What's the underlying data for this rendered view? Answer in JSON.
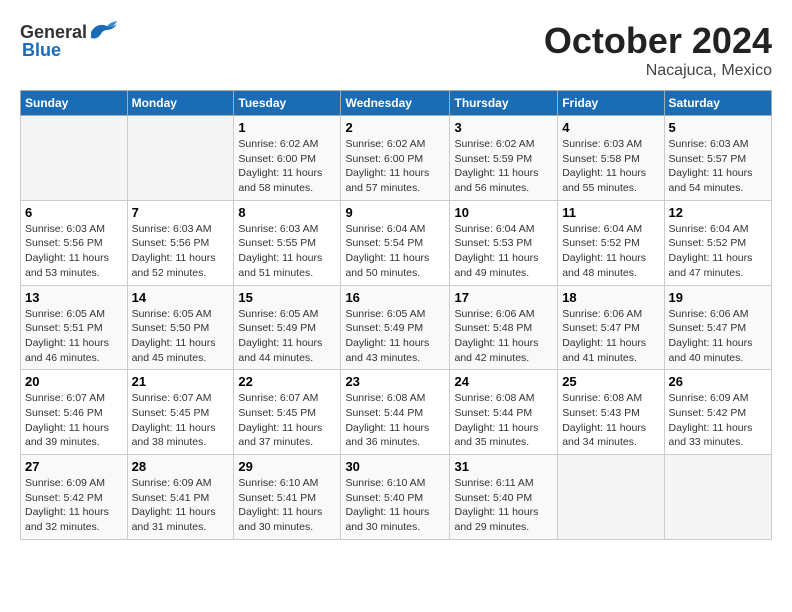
{
  "header": {
    "logo_general": "General",
    "logo_blue": "Blue",
    "month": "October 2024",
    "location": "Nacajuca, Mexico"
  },
  "weekdays": [
    "Sunday",
    "Monday",
    "Tuesday",
    "Wednesday",
    "Thursday",
    "Friday",
    "Saturday"
  ],
  "weeks": [
    [
      {
        "day": "",
        "empty": true
      },
      {
        "day": "",
        "empty": true
      },
      {
        "day": "1",
        "sunrise": "6:02 AM",
        "sunset": "6:00 PM",
        "daylight": "11 hours and 58 minutes."
      },
      {
        "day": "2",
        "sunrise": "6:02 AM",
        "sunset": "6:00 PM",
        "daylight": "11 hours and 57 minutes."
      },
      {
        "day": "3",
        "sunrise": "6:02 AM",
        "sunset": "5:59 PM",
        "daylight": "11 hours and 56 minutes."
      },
      {
        "day": "4",
        "sunrise": "6:03 AM",
        "sunset": "5:58 PM",
        "daylight": "11 hours and 55 minutes."
      },
      {
        "day": "5",
        "sunrise": "6:03 AM",
        "sunset": "5:57 PM",
        "daylight": "11 hours and 54 minutes."
      }
    ],
    [
      {
        "day": "6",
        "sunrise": "6:03 AM",
        "sunset": "5:56 PM",
        "daylight": "11 hours and 53 minutes."
      },
      {
        "day": "7",
        "sunrise": "6:03 AM",
        "sunset": "5:56 PM",
        "daylight": "11 hours and 52 minutes."
      },
      {
        "day": "8",
        "sunrise": "6:03 AM",
        "sunset": "5:55 PM",
        "daylight": "11 hours and 51 minutes."
      },
      {
        "day": "9",
        "sunrise": "6:04 AM",
        "sunset": "5:54 PM",
        "daylight": "11 hours and 50 minutes."
      },
      {
        "day": "10",
        "sunrise": "6:04 AM",
        "sunset": "5:53 PM",
        "daylight": "11 hours and 49 minutes."
      },
      {
        "day": "11",
        "sunrise": "6:04 AM",
        "sunset": "5:52 PM",
        "daylight": "11 hours and 48 minutes."
      },
      {
        "day": "12",
        "sunrise": "6:04 AM",
        "sunset": "5:52 PM",
        "daylight": "11 hours and 47 minutes."
      }
    ],
    [
      {
        "day": "13",
        "sunrise": "6:05 AM",
        "sunset": "5:51 PM",
        "daylight": "11 hours and 46 minutes."
      },
      {
        "day": "14",
        "sunrise": "6:05 AM",
        "sunset": "5:50 PM",
        "daylight": "11 hours and 45 minutes."
      },
      {
        "day": "15",
        "sunrise": "6:05 AM",
        "sunset": "5:49 PM",
        "daylight": "11 hours and 44 minutes."
      },
      {
        "day": "16",
        "sunrise": "6:05 AM",
        "sunset": "5:49 PM",
        "daylight": "11 hours and 43 minutes."
      },
      {
        "day": "17",
        "sunrise": "6:06 AM",
        "sunset": "5:48 PM",
        "daylight": "11 hours and 42 minutes."
      },
      {
        "day": "18",
        "sunrise": "6:06 AM",
        "sunset": "5:47 PM",
        "daylight": "11 hours and 41 minutes."
      },
      {
        "day": "19",
        "sunrise": "6:06 AM",
        "sunset": "5:47 PM",
        "daylight": "11 hours and 40 minutes."
      }
    ],
    [
      {
        "day": "20",
        "sunrise": "6:07 AM",
        "sunset": "5:46 PM",
        "daylight": "11 hours and 39 minutes."
      },
      {
        "day": "21",
        "sunrise": "6:07 AM",
        "sunset": "5:45 PM",
        "daylight": "11 hours and 38 minutes."
      },
      {
        "day": "22",
        "sunrise": "6:07 AM",
        "sunset": "5:45 PM",
        "daylight": "11 hours and 37 minutes."
      },
      {
        "day": "23",
        "sunrise": "6:08 AM",
        "sunset": "5:44 PM",
        "daylight": "11 hours and 36 minutes."
      },
      {
        "day": "24",
        "sunrise": "6:08 AM",
        "sunset": "5:44 PM",
        "daylight": "11 hours and 35 minutes."
      },
      {
        "day": "25",
        "sunrise": "6:08 AM",
        "sunset": "5:43 PM",
        "daylight": "11 hours and 34 minutes."
      },
      {
        "day": "26",
        "sunrise": "6:09 AM",
        "sunset": "5:42 PM",
        "daylight": "11 hours and 33 minutes."
      }
    ],
    [
      {
        "day": "27",
        "sunrise": "6:09 AM",
        "sunset": "5:42 PM",
        "daylight": "11 hours and 32 minutes."
      },
      {
        "day": "28",
        "sunrise": "6:09 AM",
        "sunset": "5:41 PM",
        "daylight": "11 hours and 31 minutes."
      },
      {
        "day": "29",
        "sunrise": "6:10 AM",
        "sunset": "5:41 PM",
        "daylight": "11 hours and 30 minutes."
      },
      {
        "day": "30",
        "sunrise": "6:10 AM",
        "sunset": "5:40 PM",
        "daylight": "11 hours and 30 minutes."
      },
      {
        "day": "31",
        "sunrise": "6:11 AM",
        "sunset": "5:40 PM",
        "daylight": "11 hours and 29 minutes."
      },
      {
        "day": "",
        "empty": true
      },
      {
        "day": "",
        "empty": true
      }
    ]
  ]
}
